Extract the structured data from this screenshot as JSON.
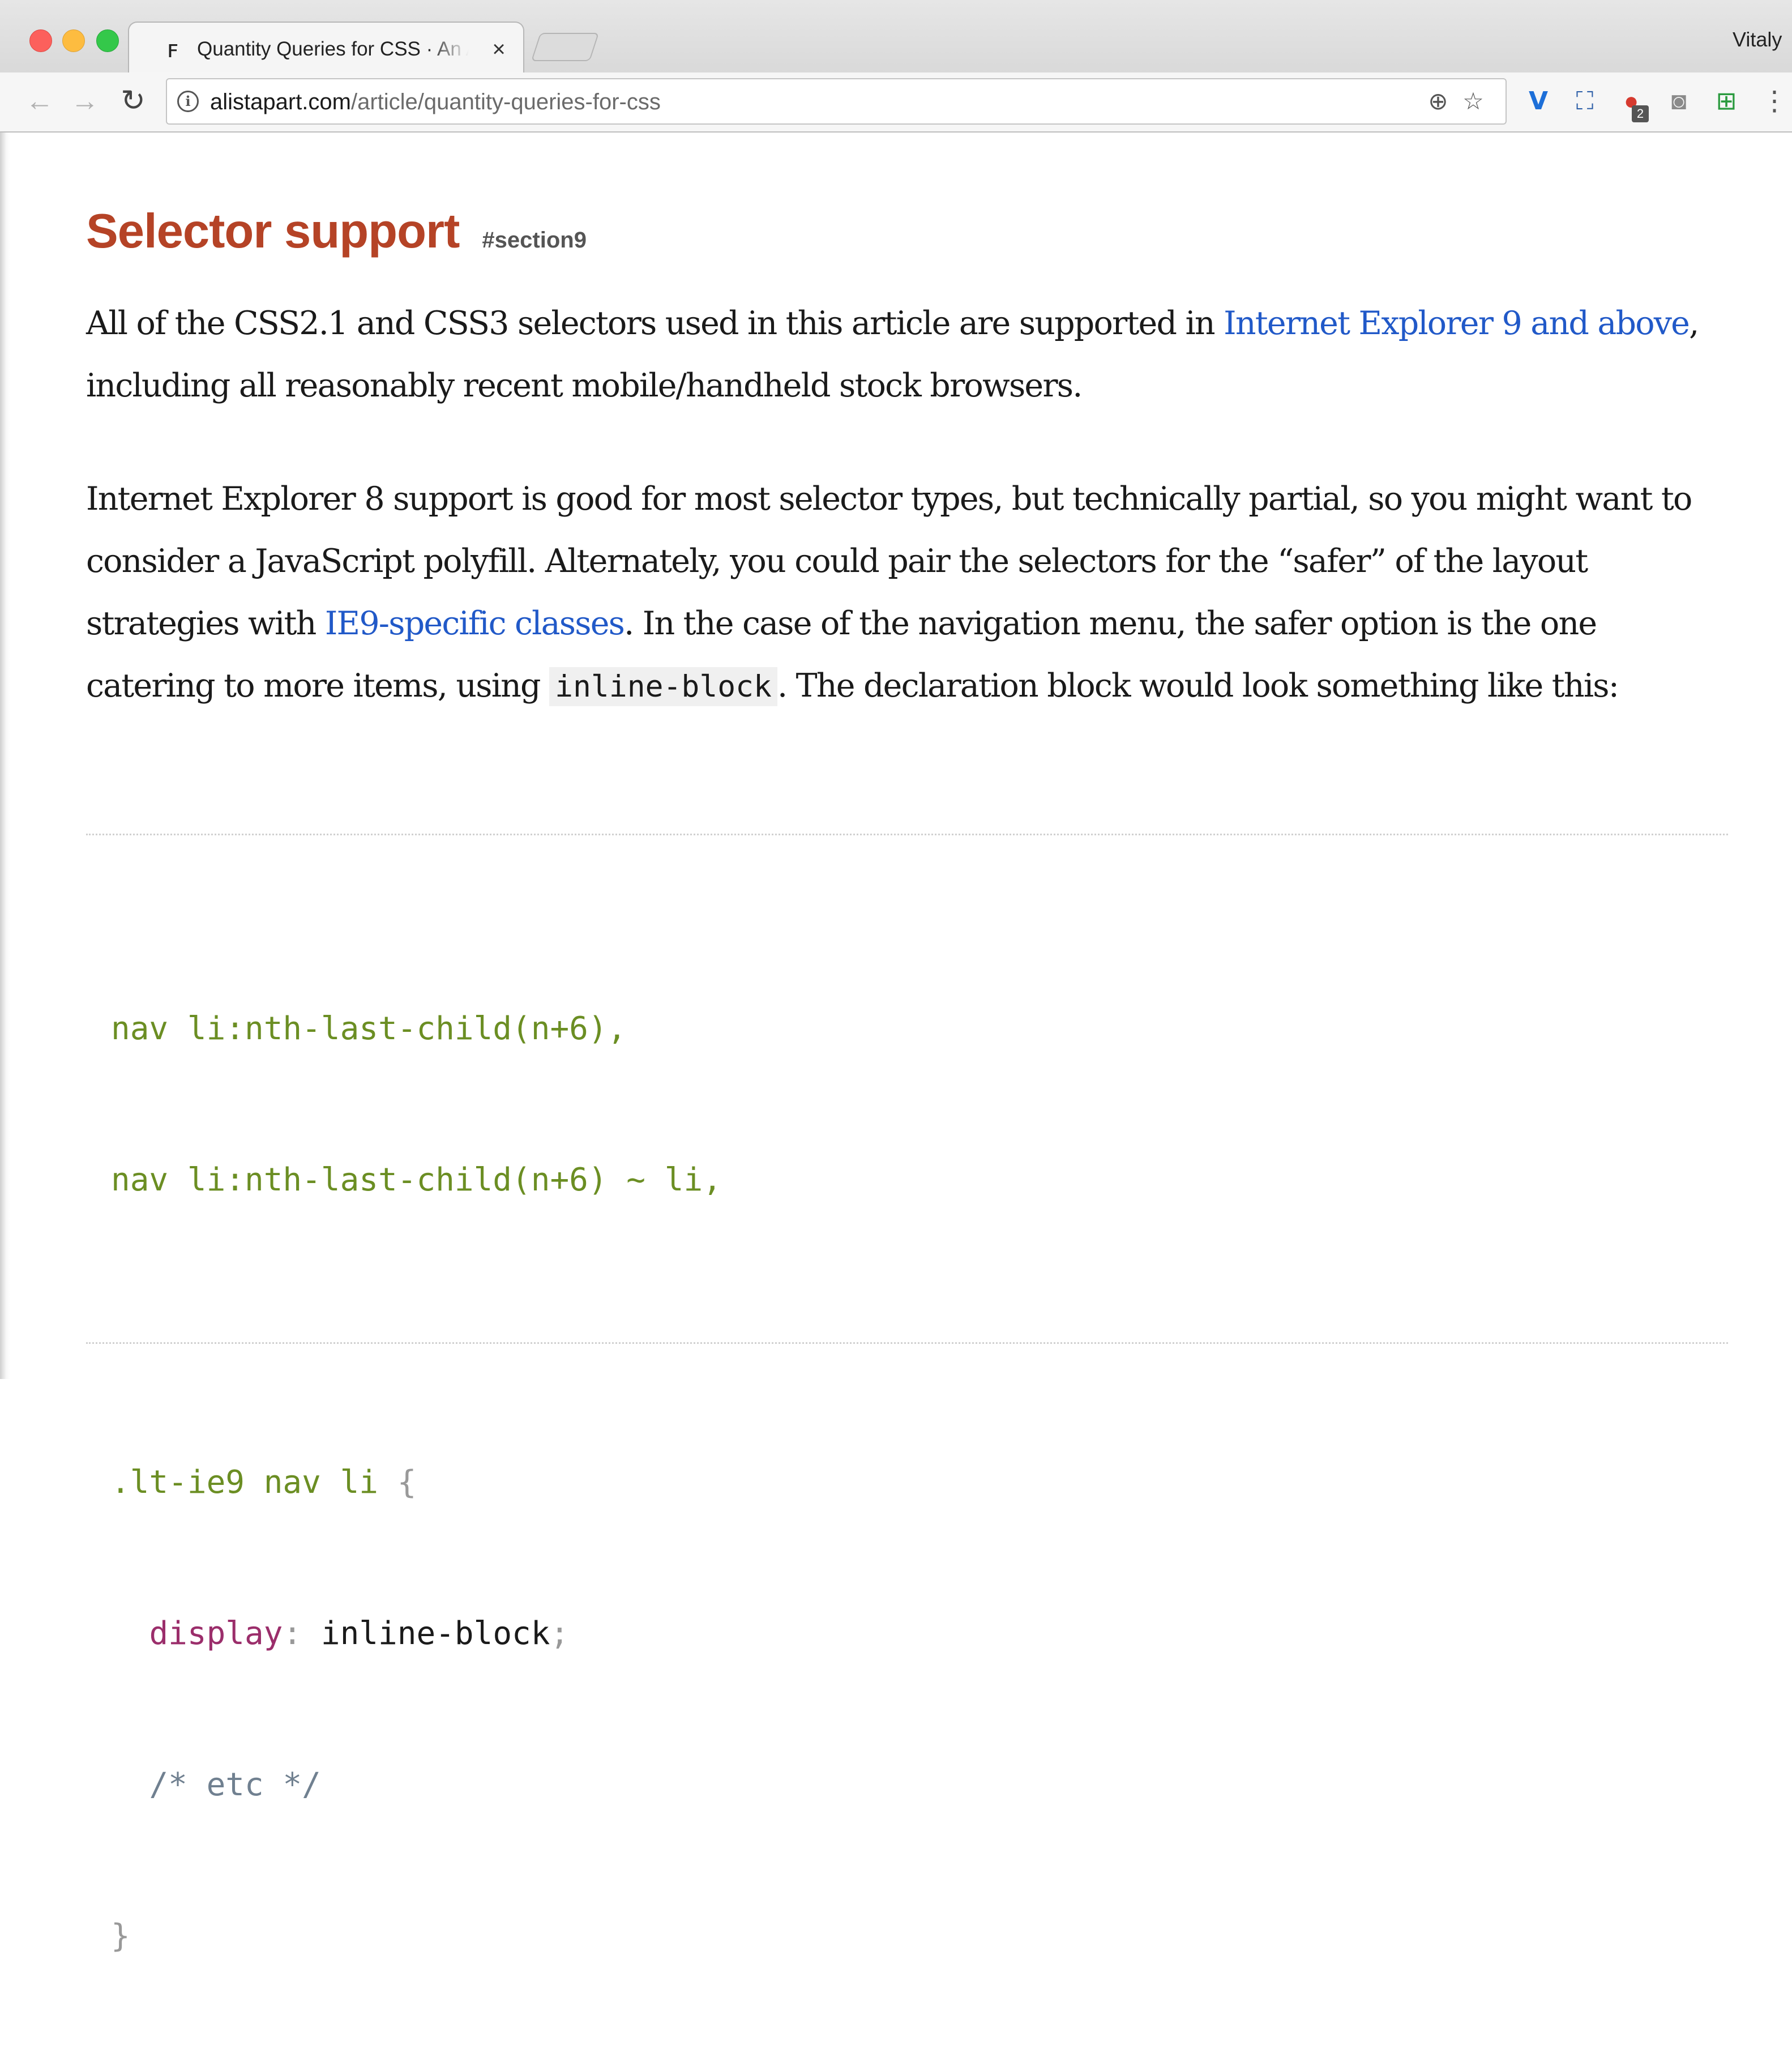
{
  "browser": {
    "tab_title": "Quantity Queries for CSS · An A",
    "tab_favicon": "ꜰ",
    "tab_close": "×",
    "profile_name": "Vitaly",
    "url_host": "alistapart.com",
    "url_path": "/article/quantity-queries-for-css",
    "icons": {
      "back": "←",
      "forward": "→",
      "reload": "↻",
      "info": "i",
      "zoom": "⊕",
      "star": "☆",
      "vimium": "V",
      "screen": "⛶",
      "adblock": "●",
      "adblock_badge": "2",
      "camera": "◙",
      "plus": "⊞",
      "menu": "⋮"
    }
  },
  "article": {
    "heading": "Selector support",
    "anchor": "#section9",
    "p1": {
      "before": "All of the CSS2.1 and CSS3 selectors used in this article are supported in ",
      "link": "Internet Explorer 9 and above",
      "after": ", including all reasonably recent mobile/handheld stock browsers."
    },
    "p2": {
      "before": "Internet Explorer 8 support is good for most selector types, but technically partial, so you might want to consider a JavaScript polyfill. Alternately, you could pair the selectors for the “safer” of the layout strategies with ",
      "link": "IE9-specific classes",
      "middle": ". In the case of the navigation menu, the safer option is the one catering to more items, using ",
      "code": "inline-block",
      "after": ". The declaration block would look something like this:"
    },
    "code": {
      "line1": "nav li:nth-last-child(n+6),",
      "line2": "nav li:nth-last-child(n+6) ~ li,",
      "line4_sel": ".lt-ie9 nav li ",
      "line4_brace": "{",
      "line5_prop": "display",
      "line5_colon": ":",
      "line5_val": " inline-block",
      "line5_semi": ";",
      "line6": "/* etc */",
      "line7": "}"
    }
  },
  "colors": {
    "heading": "#b54326",
    "link": "#2159c8",
    "code_selector": "#6b8e23",
    "code_property": "#9b2e6b"
  }
}
